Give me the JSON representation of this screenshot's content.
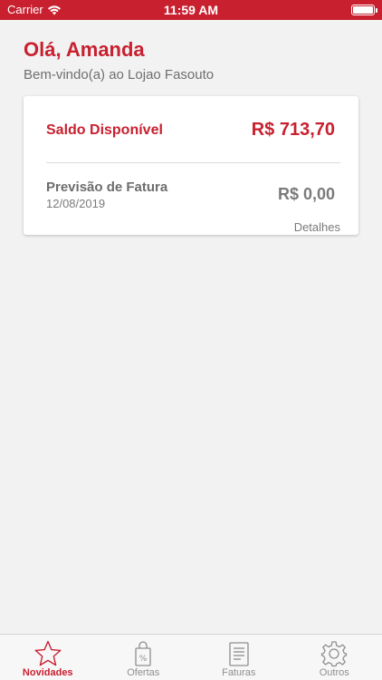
{
  "status_bar": {
    "carrier": "Carrier",
    "time": "11:59 AM"
  },
  "header": {
    "greeting": "Olá, Amanda",
    "welcome": "Bem-vindo(a) ao Lojao Fasouto"
  },
  "card": {
    "saldo_label": "Saldo Disponível",
    "saldo_value": "R$ 713,70",
    "previsao_label": "Previsão de Fatura",
    "previsao_date": "12/08/2019",
    "previsao_value": "R$ 0,00",
    "details_link": "Detalhes"
  },
  "tabs": [
    {
      "label": "Novidades",
      "icon": "star-icon",
      "active": true
    },
    {
      "label": "Ofertas",
      "icon": "shopping-bag-icon",
      "active": false
    },
    {
      "label": "Faturas",
      "icon": "invoice-icon",
      "active": false
    },
    {
      "label": "Outros",
      "icon": "gear-icon",
      "active": false
    }
  ],
  "colors": {
    "brand": "#c8202f",
    "text_gray": "#6f6f6f",
    "background": "#f2f2f2",
    "inactive_tab": "#8e8e8e"
  }
}
